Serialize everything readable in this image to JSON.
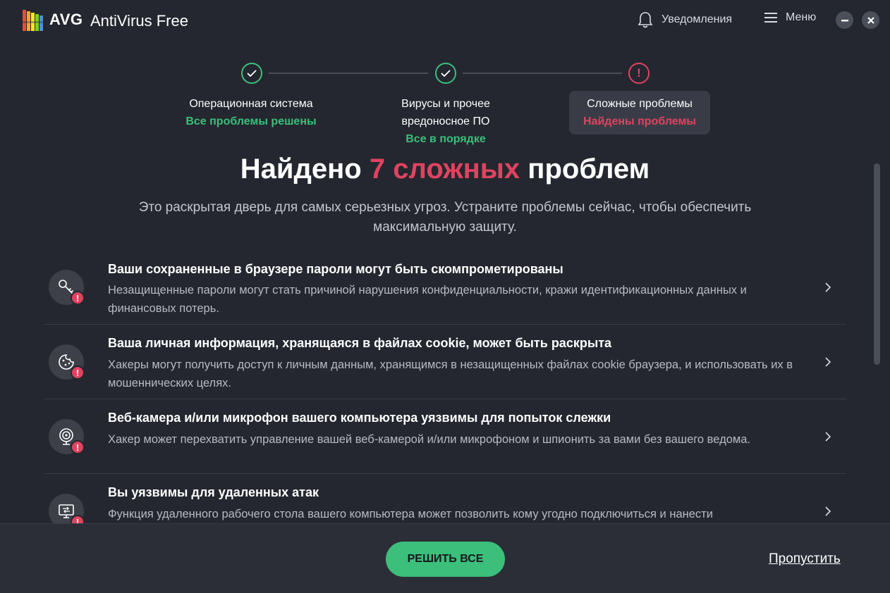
{
  "app": {
    "logo_text": "AVG",
    "name": "AntiVirus Free",
    "notifications_label": "Уведомления",
    "menu_label": "Меню"
  },
  "steps": [
    {
      "title": "Операционная система",
      "status": "Все проблемы решены",
      "state": "ok"
    },
    {
      "title_line1": "Вирусы и прочее",
      "title_line2": "вредоносное ПО",
      "status": "Все в порядке",
      "state": "ok"
    },
    {
      "title": "Сложные проблемы",
      "status": "Найдены проблемы",
      "state": "problem",
      "icon": "!"
    }
  ],
  "headline": {
    "prefix": "Найдено",
    "highlight": "7 сложных",
    "suffix": "проблем"
  },
  "subtitle": "Это раскрытая дверь для самых серьезных угроз. Устраните проблемы сейчас, чтобы обеспечить максимальную защиту.",
  "issues": [
    {
      "icon": "key-icon",
      "title": "Ваши сохраненные в браузере пароли могут быть скомпрометированы",
      "description": "Незащищенные пароли могут стать причиной нарушения конфиденциальности, кражи идентификационных данных и финансовых потерь."
    },
    {
      "icon": "cookie-icon",
      "title": "Ваша личная информация, хранящаяся в файлах cookie, может быть раскрыта",
      "description": "Хакеры могут получить доступ к личным данным, хранящимся в незащищенных файлах cookie браузера, и использовать их в мошеннических целях."
    },
    {
      "icon": "webcam-icon",
      "title": "Веб-камера и/или микрофон вашего компьютера уязвимы для попыток слежки",
      "description": "Хакер может перехватить управление вашей веб-камерой и/или микрофоном и шпионить за вами без вашего ведома."
    },
    {
      "icon": "remote-desktop-icon",
      "title": "Вы уязвимы для удаленных атак",
      "description": "Функция удаленного рабочего стола вашего компьютера может позволить кому угодно подключиться и нанести"
    }
  ],
  "badge_symbol": "!",
  "footer": {
    "fix_all_label": "РЕШИТЬ ВСЕ",
    "skip_label": "Пропустить"
  },
  "colors": {
    "background": "#24272f",
    "accent_green": "#3bbf7a",
    "alert_red": "#e0435f"
  }
}
